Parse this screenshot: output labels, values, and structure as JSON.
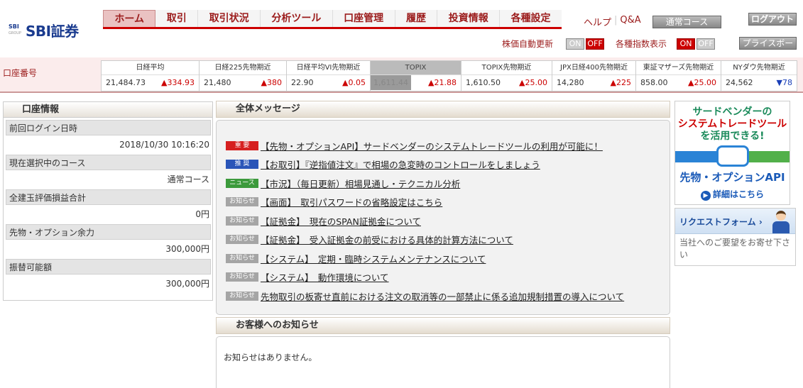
{
  "brand": {
    "logo_small": "SBI",
    "logo_group": "GROUP",
    "name": "SBI証券"
  },
  "nav": {
    "items": [
      "ホーム",
      "取引",
      "取引状況",
      "分析ツール",
      "口座管理",
      "履歴",
      "投資情報",
      "各種設定"
    ],
    "help": "ヘルプ",
    "qa": "Q&A",
    "course": "通常コース",
    "logout": "ログアウト",
    "board": "プライスボード"
  },
  "toggles": {
    "auto_update_label": "株価自動更新",
    "index_display_label": "各種指数表示",
    "on": "ON",
    "off": "OFF"
  },
  "account": {
    "label": "口座番号"
  },
  "indices": [
    {
      "name": "日経平均",
      "value": "21,484.73",
      "change": "▲334.93",
      "dir": "up"
    },
    {
      "name": "日経225先物期近",
      "value": "21,480",
      "change": "▲380",
      "dir": "up"
    },
    {
      "name": "日経平均VI先物期近",
      "value": "22.90",
      "change": "▲0.05",
      "dir": "up"
    },
    {
      "name": "TOPIX",
      "value": "1,611.44",
      "change": "▲21.88",
      "dir": "up"
    },
    {
      "name": "TOPIX先物期近",
      "value": "1,610.50",
      "change": "▲25.00",
      "dir": "up"
    },
    {
      "name": "JPX日経400先物期近",
      "value": "14,280",
      "change": "▲225",
      "dir": "up"
    },
    {
      "name": "東証マザーズ先物期近",
      "value": "858.00",
      "change": "▲25.00",
      "dir": "up"
    },
    {
      "name": "NYダウ先物期近",
      "value": "24,562",
      "change": "▼78",
      "dir": "down"
    }
  ],
  "account_info": {
    "title": "口座情報",
    "rows": [
      {
        "label": "前回ログイン日時",
        "value": "2018/10/30 10:16:20"
      },
      {
        "label": "現在選択中のコース",
        "value": "通常コース"
      },
      {
        "label": "全建玉評価損益合計",
        "value": "0円"
      },
      {
        "label": "先物・オプション余力",
        "value": "300,000円"
      },
      {
        "label": "振替可能額",
        "value": "300,000円"
      }
    ]
  },
  "messages": {
    "title": "全体メッセージ",
    "items": [
      {
        "badge": "重 要",
        "color": "red",
        "text": "【先物・オプションAPI】サードベンダーのシステムトレードツールの利用が可能に！"
      },
      {
        "badge": "推 奨",
        "color": "blue",
        "text": "【お取引】『逆指値注文』で相場の急変時のコントロールをしましょう"
      },
      {
        "badge": "ニュース",
        "color": "green",
        "text": "【市況】（毎日更新）相場見通し・テクニカル分析"
      },
      {
        "badge": "お知らせ",
        "color": "gray",
        "text": "【画面】　取引パスワードの省略設定はこちら"
      },
      {
        "badge": "お知らせ",
        "color": "gray",
        "text": "【証拠金】　現在のSPAN証拠金について"
      },
      {
        "badge": "お知らせ",
        "color": "gray",
        "text": "【証拠金】　受入証拠金の前受における具体的計算方法について"
      },
      {
        "badge": "お知らせ",
        "color": "gray",
        "text": "【システム】　定期・臨時システムメンテナンスについて"
      },
      {
        "badge": "お知らせ",
        "color": "gray",
        "text": "【システム】　動作環境について"
      },
      {
        "badge": "お知らせ",
        "color": "gray",
        "text": "先物取引の板寄せ直前における注文の取消等の一部禁止に係る追加規制措置の導入について"
      }
    ]
  },
  "notice": {
    "title": "お客様へのお知らせ",
    "text": "お知らせはありません。"
  },
  "banner": {
    "line1": "サードベンダーの",
    "line2": "システムトレードツール",
    "line3": "を活用できる!",
    "product": "先物・オプションAPI",
    "detail": "詳細はこちら",
    "play": "▶"
  },
  "request": {
    "title": "リクエストフォーム ›",
    "text": "当社へのご要望をお寄せ下さい"
  }
}
